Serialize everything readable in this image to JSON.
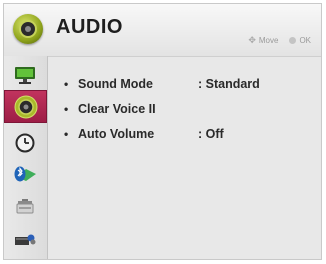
{
  "header": {
    "title": "AUDIO",
    "hint_move": "Move",
    "hint_ok": "OK"
  },
  "sidebar": {
    "items": [
      {
        "icon": "picture-monitor-icon"
      },
      {
        "icon": "audio-speaker-icon",
        "active": true
      },
      {
        "icon": "clock-icon"
      },
      {
        "icon": "bluetooth-icon"
      },
      {
        "icon": "lock-icon"
      },
      {
        "icon": "option-icon"
      }
    ]
  },
  "menu": {
    "items": [
      {
        "label": "Sound Mode",
        "value": ": Standard"
      },
      {
        "label": "Clear Voice II",
        "value": ""
      },
      {
        "label": "Auto Volume",
        "value": ": Off"
      }
    ]
  },
  "colors": {
    "accent": "#b0264f",
    "background": "#e6e6e6"
  }
}
